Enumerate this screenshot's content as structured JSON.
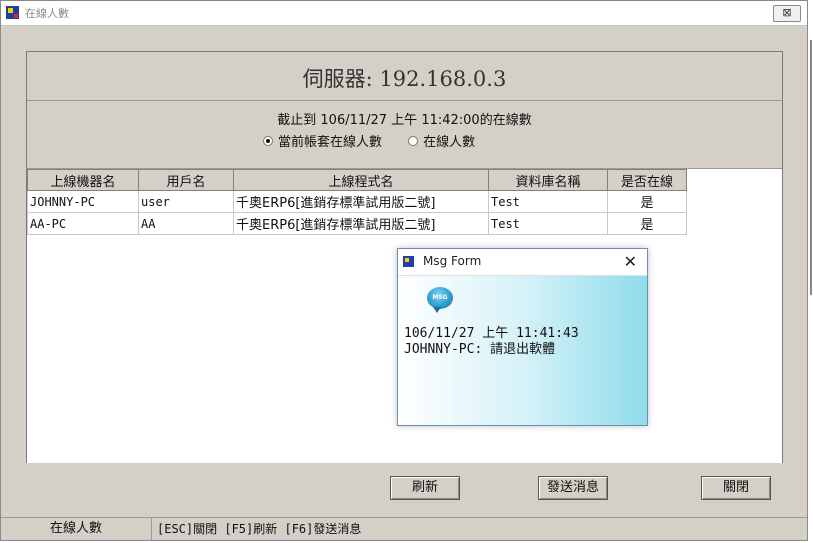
{
  "window": {
    "title": "在線人數",
    "close_label": "⊠"
  },
  "server": {
    "title": "伺服器:  192.168.0.3"
  },
  "cutoff_text": "截止到  106/11/27 上午 11:42:00的在線數",
  "radios": [
    {
      "label": "當前帳套在線人數",
      "checked": true
    },
    {
      "label": "在線人數",
      "checked": false
    }
  ],
  "table": {
    "columns": [
      "上線機器名",
      "用戶名",
      "上線程式名",
      "資料庫名稱",
      "是否在線"
    ],
    "rows": [
      [
        "JOHNNY-PC",
        "user",
        "千奧ERP6[進銷存標準試用版二號]",
        "Test",
        "是"
      ],
      [
        "AA-PC",
        "AA",
        "千奧ERP6[進銷存標準試用版二號]",
        "Test",
        "是"
      ]
    ]
  },
  "buttons": {
    "refresh": "刷新",
    "send": "發送消息",
    "close": "關閉"
  },
  "status": {
    "left": "在線人數",
    "hint": "[ESC]關閉 [F5]刷新 [F6]發送消息"
  },
  "msg_form": {
    "title": "Msg Form",
    "close": "✕",
    "logo": "MSG",
    "line1": "106/11/27 上午 11:41:43",
    "line2": "JOHNNY-PC: 請退出軟體"
  }
}
